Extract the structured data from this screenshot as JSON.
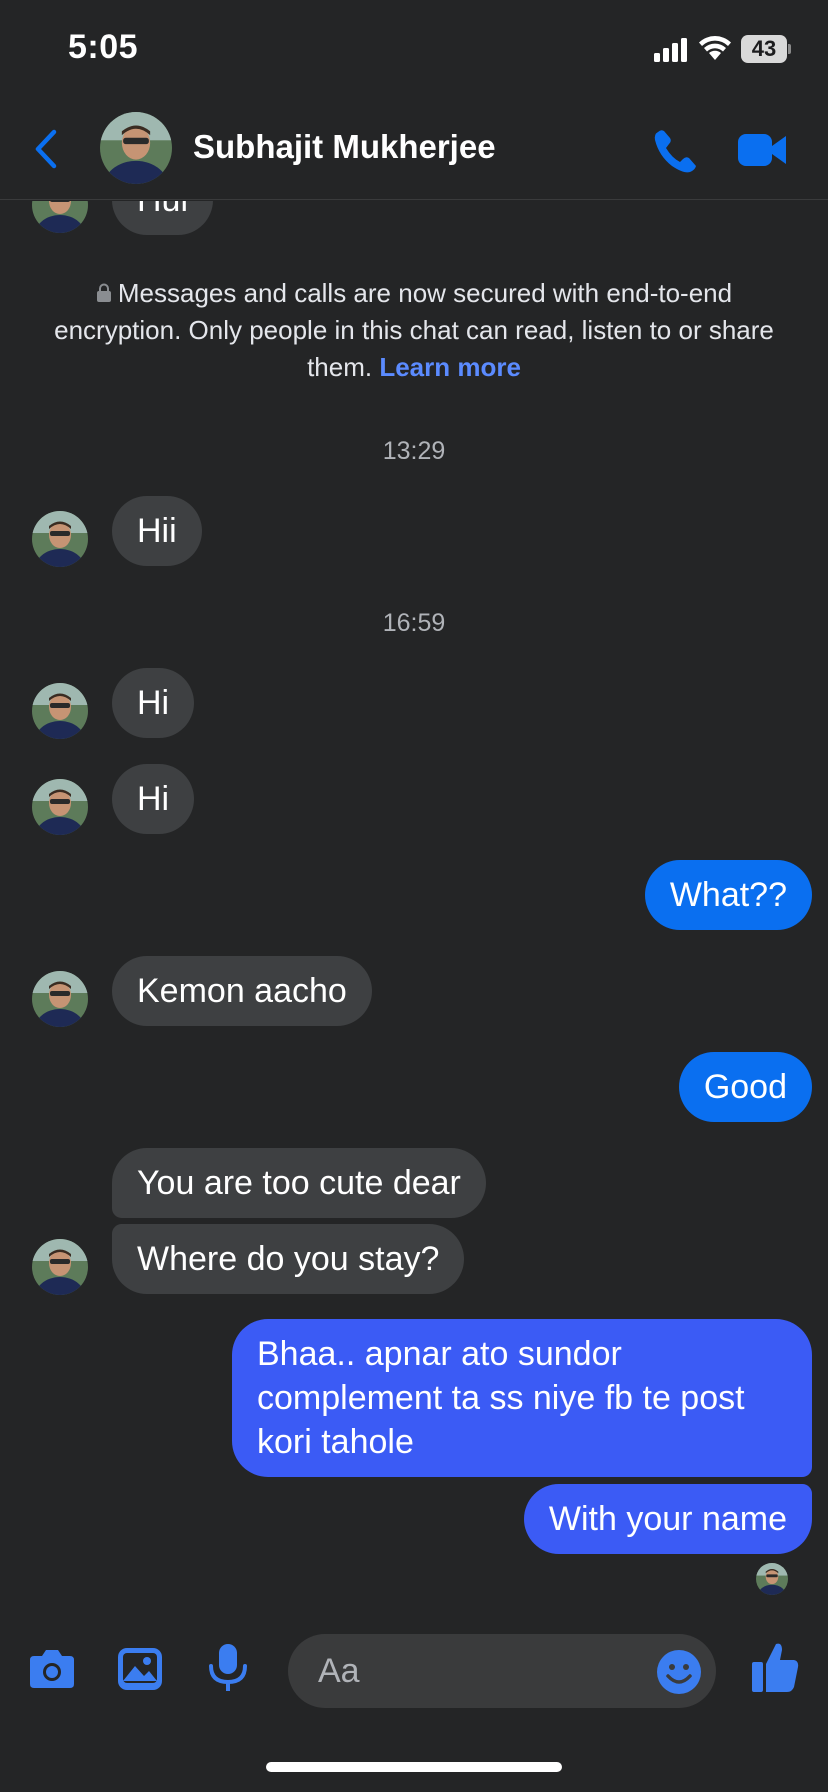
{
  "status": {
    "time": "5:05",
    "battery": "43"
  },
  "header": {
    "contact_name": "Subhajit Mukherjee"
  },
  "thread": {
    "partial_message": "Hui",
    "encryption_notice": "Messages and calls are now secured with end-to-end encryption. Only people in this chat can read, listen to or share them.",
    "learn_more": "Learn more",
    "timestamps": [
      "13:29",
      "16:59"
    ],
    "messages": [
      {
        "from": "them",
        "text": "Hii"
      },
      {
        "from": "them",
        "text": "Hi"
      },
      {
        "from": "them",
        "text": "Hi"
      },
      {
        "from": "me",
        "text": "What??"
      },
      {
        "from": "them",
        "text": "Kemon aacho"
      },
      {
        "from": "me",
        "text": "Good"
      },
      {
        "from": "them",
        "text": "You are too cute dear"
      },
      {
        "from": "them",
        "text": "Where do you stay?"
      },
      {
        "from": "me",
        "text": "Bhaa.. apnar ato sundor complement ta ss niye fb te post kori tahole"
      },
      {
        "from": "me",
        "text": "With your name"
      }
    ]
  },
  "composer": {
    "placeholder": "Aa"
  },
  "colors": {
    "background": "#242526",
    "accent": "#0a6ff0",
    "incoming_bubble": "#3e4042",
    "outgoing_bubble": "#3b5bf5"
  },
  "icons": [
    "back-icon",
    "phone-icon",
    "video-icon",
    "camera-icon",
    "gallery-icon",
    "microphone-icon",
    "emoji-icon",
    "like-icon",
    "lock-icon"
  ]
}
